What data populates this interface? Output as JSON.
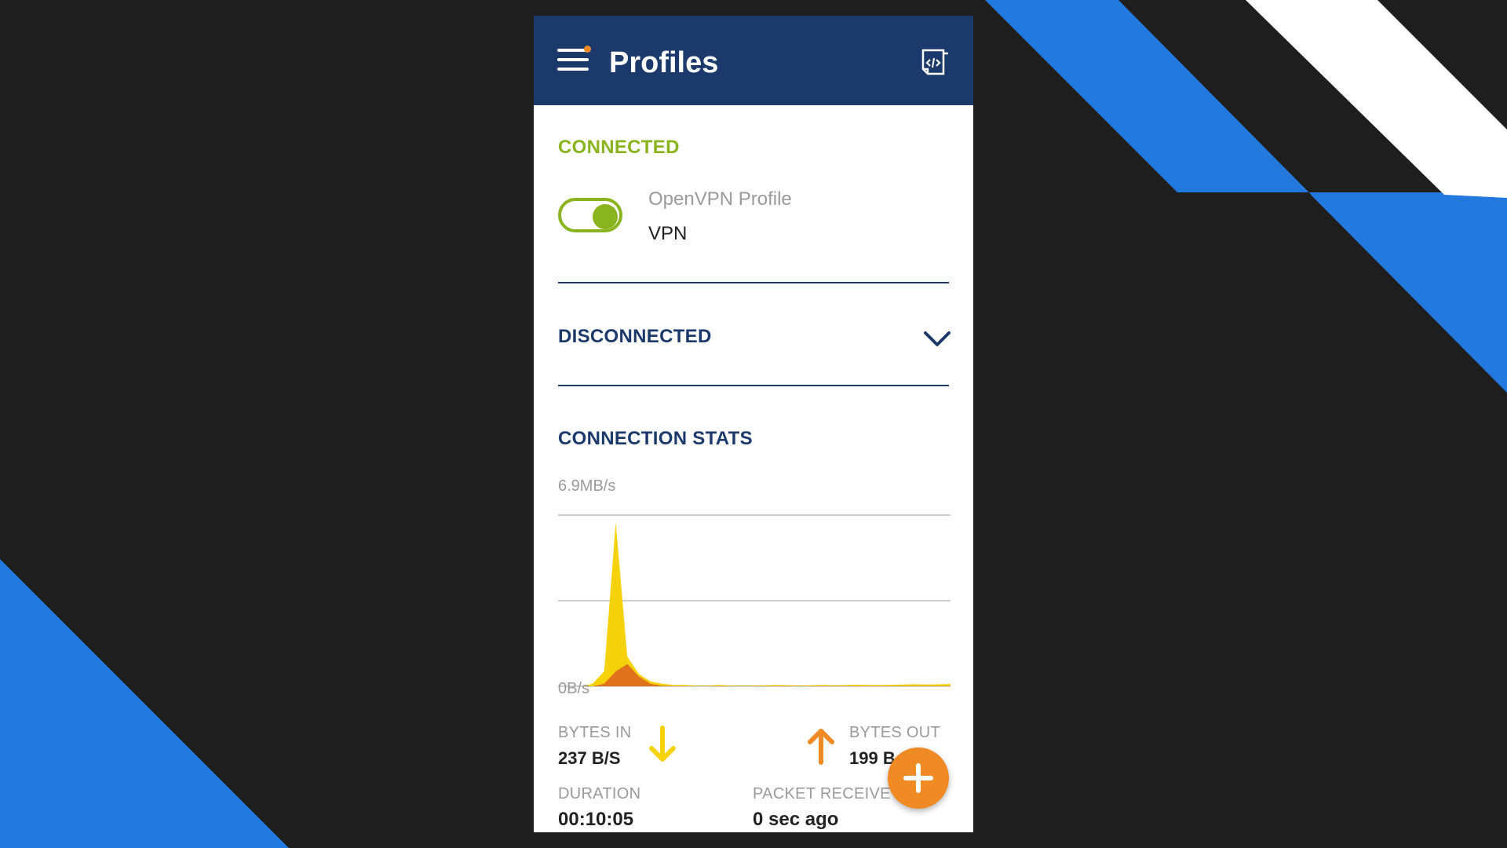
{
  "app_bar": {
    "title": "Profiles",
    "menu_icon": "hamburger-icon",
    "badge_color": "#f08a24",
    "action_icon": "import-profile-icon",
    "background": "#1b3a6b"
  },
  "connected_section": {
    "label": "CONNECTED",
    "label_color": "#8ab41d",
    "profile": {
      "name": "OpenVPN Profile",
      "subtitle": "VPN",
      "toggle_on": true
    }
  },
  "disconnected_section": {
    "label": "DISCONNECTED",
    "expand_icon": "chevron-down-icon"
  },
  "stats": {
    "title": "CONNECTION STATS",
    "bytes_in": {
      "label": "BYTES IN",
      "value": "237 B/S",
      "icon": "arrow-down-icon",
      "color": "#f5d20a"
    },
    "bytes_out": {
      "label": "BYTES OUT",
      "value": "199 B",
      "icon": "arrow-up-icon",
      "color": "#f08a24"
    },
    "duration": {
      "label": "DURATION",
      "value": "00:10:05"
    },
    "packet_received": {
      "label": "PACKET RECEIVE",
      "value": "0 sec ago"
    }
  },
  "chart_data": {
    "type": "area",
    "y_max_label": "6.9MB/s",
    "y_min_label": "0B/s",
    "ylim": [
      0,
      6.9
    ],
    "grid": true,
    "series": [
      {
        "values": [
          0,
          0,
          0,
          0.1,
          0.6,
          6.6,
          1.2,
          0.5,
          0.2,
          0.1,
          0.05,
          0.05,
          0.03,
          0.03,
          0.05,
          0.03,
          0.03,
          0.03,
          0.04,
          0.05,
          0.04,
          0.03,
          0.04,
          0.05,
          0.04,
          0.05,
          0.06,
          0.05,
          0.05,
          0.06,
          0.07,
          0.08,
          0.07,
          0.08,
          0.09
        ],
        "color": "#f5d20a"
      },
      {
        "values": [
          0,
          0,
          0,
          0,
          0.1,
          0.6,
          0.9,
          0.4,
          0.1,
          0.02,
          0.01,
          0.01,
          0.01,
          0.01,
          0.01,
          0.01,
          0.01,
          0.01,
          0.01,
          0.01,
          0.01,
          0.01,
          0.01,
          0.01,
          0.01,
          0.01,
          0.01,
          0.01,
          0.01,
          0.01,
          0.01,
          0.01,
          0.01,
          0.01,
          0.01
        ],
        "color": "#e0731c"
      }
    ]
  },
  "fab": {
    "icon": "plus-icon",
    "color": "#f08a24"
  }
}
